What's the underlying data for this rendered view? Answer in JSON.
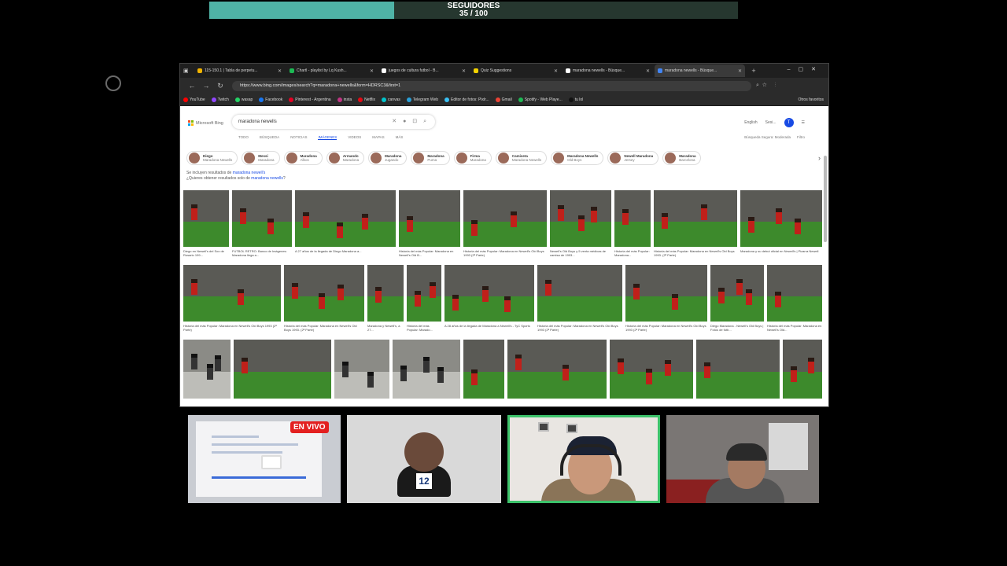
{
  "followers": {
    "label": "SEGUIDORES",
    "count_text": "35 / 100",
    "progress": 0.35,
    "fill_color": "#4fb3a6",
    "track_color": "#26372f"
  },
  "browser": {
    "tabs": [
      {
        "label": "115-150.1 | Tabla de perpetu...",
        "icon_color": "#f3b400",
        "active": false
      },
      {
        "label": "Chartl - playlist by Lq Kush...",
        "icon_color": "#1db954",
        "active": false
      },
      {
        "label": "juegos de cultura futbol - B...",
        "icon_color": "#ffffff",
        "active": false
      },
      {
        "label": "Quiz Suggestions",
        "icon_color": "#f3d200",
        "active": false
      },
      {
        "label": "maradona newells - Búsque...",
        "icon_color": "#ffffff",
        "active": false
      },
      {
        "label": "maradona newells - Búsque...",
        "icon_color": "#4285f4",
        "active": true
      }
    ],
    "url": "https://www.bing.com/images/search?q=maradona+newells&form=HDRSC3&first=1",
    "bookmarks": [
      {
        "label": "YouTube",
        "icon_color": "#ff0000"
      },
      {
        "label": "Twitch",
        "icon_color": "#9146ff"
      },
      {
        "label": "wasap",
        "icon_color": "#25d366"
      },
      {
        "label": "Facebook",
        "icon_color": "#1877f2"
      },
      {
        "label": "Pinterest - Argentina",
        "icon_color": "#e60023"
      },
      {
        "label": "insta",
        "icon_color": "#c13584"
      },
      {
        "label": "Netflix",
        "icon_color": "#e50914"
      },
      {
        "label": "canvas",
        "icon_color": "#00c4cc"
      },
      {
        "label": "Telegram Web",
        "icon_color": "#2aa1da"
      },
      {
        "label": "Editor de fotos: Pixlr...",
        "icon_color": "#3ac1f5"
      },
      {
        "label": "Gmail",
        "icon_color": "#ea4335"
      },
      {
        "label": "Spotify - Web Playe...",
        "icon_color": "#1db954"
      },
      {
        "label": "tu lol",
        "icon_color": "#111111"
      }
    ],
    "bookmarks_other": "Otros favoritos"
  },
  "bing": {
    "logo_text": "Microsoft Bing",
    "query": "maradona newells",
    "header_right": [
      "English",
      "Sesi..."
    ],
    "user_initial": "T",
    "sub_tabs": [
      "TODO",
      "BÚSQUEDA",
      "NOTICIAS",
      "IMÁGENES",
      "VIDEOS",
      "MAPAS",
      "MÁS"
    ],
    "active_sub_tab": 3,
    "filters_right": [
      "Búsqueda Segura: Moderada",
      "Filtro"
    ],
    "chips": [
      {
        "line1": "Diego",
        "line2": "Maradona Newells"
      },
      {
        "line1": "Messi",
        "line2": "Maradona"
      },
      {
        "line1": "Maradona",
        "line2": "Albos"
      },
      {
        "line1": "Armando",
        "line2": "Maradona"
      },
      {
        "line1": "Maradona",
        "line2": "Jugando"
      },
      {
        "line1": "Maradona",
        "line2": "Puma"
      },
      {
        "line1": "Firma",
        "line2": "Maradona"
      },
      {
        "line1": "Camiseta",
        "line2": "Maradona Newells"
      },
      {
        "line1": "Maradona Newells",
        "line2": "Old Boys"
      },
      {
        "line1": "Newell Maradona",
        "line2": "Jersey"
      },
      {
        "line1": "Maradona",
        "line2": "Barcelona"
      }
    ],
    "notice_prefix": "Se incluyen resultados de",
    "notice_query": "maradona newell's",
    "notice_alt_prefix": "¿Quieres obtener resultados solo de",
    "notice_alt_query": "maradona newells",
    "notice_alt_suffix": "?",
    "row1_captions": [
      "Diego en Newell's del Sox de Rosario 199...",
      "FUTBOL RETRO: Banco de Imágenes: Maradona llega a...",
      "A 27 años de la llegada de Diego Maradona a...",
      "Historia del más Popular: Maradona en Newell's Old B...",
      "Historia del más Popular: Maradona en Newell's Old Boys 1993 (2ª Parte)",
      "Newell's Old Boys y 5 venta médicas de camisa de 1993...",
      "Historia del más Popular: Maradona...",
      "Historia del más Popular: Maradona en Newell's Old Boys 1993. (2ª Parte)",
      "Maradona y su debut oficial en Newell's | Pizarra Newell"
    ],
    "row2_captions": [
      "Historia del más Popular: Maradona en Newell's Old Boys 1993 (2ª Parte)",
      "Historia del más Popular: Maradona en Newell's Old Boys 1993. (2ª Parte)",
      "Maradona y Newell's, a 27...",
      "Historia del más Popular: Marado...",
      "A 28 años de la llegada de Maradona a Newell's - TyC Sports",
      "Historia del más Popular: Maradona en Newell's Old Boys 1993 (2ª Parte)",
      "Historia del más Popular: Maradona en Newell's Old Boys 1993 (2ª Parte)",
      "Diego Maradona - Newell's Old Boys | Fotos de fútb...",
      "Historia del más Popular: Maradona en Newell's Old..."
    ]
  },
  "stream": {
    "live_label": "EN VIVO",
    "live_color": "#e32020",
    "guest_jersey_number": "12",
    "active_speaker_border": "#3cc26a"
  }
}
